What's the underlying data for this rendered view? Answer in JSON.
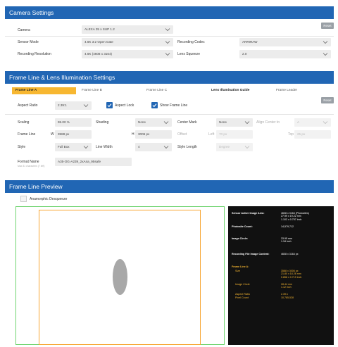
{
  "camera_settings": {
    "title": "Camera Settings",
    "reset_label": "Reset",
    "camera_label": "Camera",
    "camera_value": "ALEXA 35 x SUP 1.2",
    "sensor_mode_label": "Sensor Mode",
    "sensor_mode_value": "4.6K 3:2 Open Gate",
    "recording_codec_label": "Recording Codec",
    "recording_codec_value": "ARRIRAW",
    "recording_resolution_label": "Recording Resolution",
    "recording_resolution_value": "4.6K (4608 x 3164)",
    "lens_squeeze_label": "Lens Squeeze",
    "lens_squeeze_value": "2.0"
  },
  "frame_line_settings": {
    "title": "Frame Line & Lens Illumination Settings",
    "tabs": [
      "Frame Line A",
      "Frame Line B",
      "Frame Line C",
      "Lens Illumination Guide",
      "Frame Leader"
    ],
    "reset_label": "Reset",
    "aspect_ratio_label": "Aspect Ratio",
    "aspect_ratio_value": "2.39:1",
    "aspect_lock_label": "Aspect Lock",
    "show_frame_line_label": "Show Frame Line",
    "scaling_label": "Scaling",
    "scaling_value": "95.00 %",
    "shading_label": "Shading",
    "shading_value": "None",
    "center_mark_label": "Center Mark",
    "center_mark_value": "None",
    "align_center_to_label": "Align Center to",
    "align_center_to_value": "A",
    "frame_line_label": "Frame Line",
    "w_label": "W",
    "w_value": "3588 px",
    "h_label": "H",
    "h_value": "3006 px",
    "offset_label": "Offset",
    "left_label": "Left",
    "left_value": "70 px",
    "top_label": "Top",
    "top_value": "25 px",
    "style_label": "Style",
    "style_value": "Full Box",
    "line_width_label": "Line Width",
    "line_width_value": "4",
    "style_length_label": "Style Length",
    "style_length_value": "Degree",
    "format_name_label": "Format Name",
    "format_name_hint": "Max 31 characters (7 left)",
    "format_name_value": "A35-OG-A239_2xAna_95safe"
  },
  "preview": {
    "title": "Frame Line Preview",
    "anamorphic_label": "Anamorphic Desqueeze",
    "info": {
      "sensor_area_label": "Sensor Active Image Area:",
      "sensor_area_value": "4608 x 3164 (Photosites)\n27.99 x 19.22 mm\n1.102 x 0.757 inch",
      "photosite_label": "Photosite Count:",
      "photosite_value": "14,579,712",
      "image_circle_label": "Image Circle:",
      "image_circle_value": "33.95 mm\n1.34 inch",
      "file_content_label": "Recording File Image Content:",
      "file_content_value": "4608 x 3164 px",
      "frame_a_label": "Frame Line A:",
      "size_label": "Size",
      "size_value": "3588 x 3006 px\n21.80 x 18.26 mm\n0.858 x 0.719 inch",
      "ic_label": "Image Circle",
      "ic_value": "28.44 mm\n1.12 inch",
      "ar_label": "Aspect Ratio",
      "ar_value": "2.39:1",
      "pc_label": "Pixel Count",
      "pc_value": "10,785,528"
    }
  }
}
